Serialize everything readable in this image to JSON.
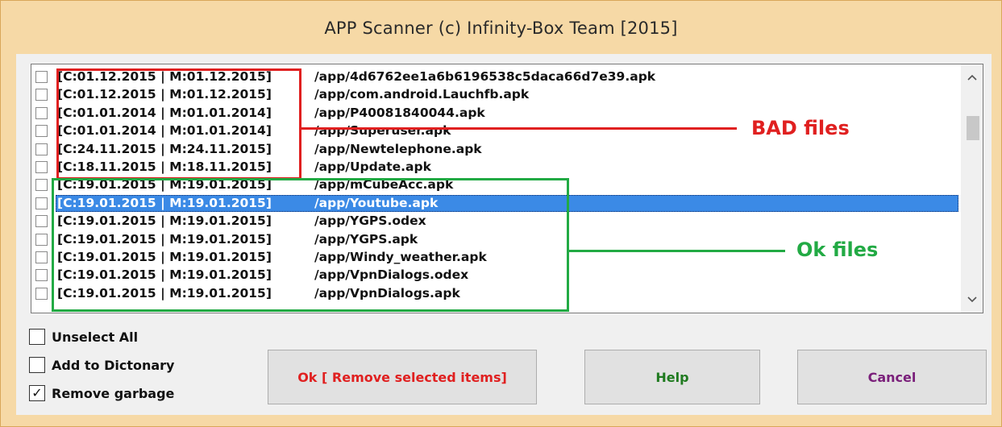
{
  "window": {
    "title": "APP Scanner (c) Infinity-Box Team [2015]"
  },
  "list": {
    "rows": [
      {
        "dates": "[C:01.12.2015 | M:01.12.2015]",
        "path": "/app/4d6762ee1a6b6196538c5daca66d7e39.apk",
        "checked": false
      },
      {
        "dates": "[C:01.12.2015 | M:01.12.2015]",
        "path": "/app/com.android.Lauchfb.apk",
        "checked": false
      },
      {
        "dates": "[C:01.01.2014 | M:01.01.2014]",
        "path": "/app/P40081840044.apk",
        "checked": false
      },
      {
        "dates": "[C:01.01.2014 | M:01.01.2014]",
        "path": "/app/Superuser.apk",
        "checked": false
      },
      {
        "dates": "[C:24.11.2015 | M:24.11.2015]",
        "path": "/app/Newtelephone.apk",
        "checked": false
      },
      {
        "dates": "[C:18.11.2015 | M:18.11.2015]",
        "path": "/app/Update.apk",
        "checked": false
      },
      {
        "dates": "[C:19.01.2015 | M:19.01.2015]",
        "path": "/app/mCubeAcc.apk",
        "checked": false
      },
      {
        "dates": "[C:19.01.2015 | M:19.01.2015]",
        "path": "/app/Youtube.apk",
        "checked": false,
        "selected": true
      },
      {
        "dates": "[C:19.01.2015 | M:19.01.2015]",
        "path": "/app/YGPS.odex",
        "checked": false
      },
      {
        "dates": "[C:19.01.2015 | M:19.01.2015]",
        "path": "/app/YGPS.apk",
        "checked": false
      },
      {
        "dates": "[C:19.01.2015 | M:19.01.2015]",
        "path": "/app/Windy_weather.apk",
        "checked": false
      },
      {
        "dates": "[C:19.01.2015 | M:19.01.2015]",
        "path": "/app/VpnDialogs.odex",
        "checked": false
      },
      {
        "dates": "[C:19.01.2015 | M:19.01.2015]",
        "path": "/app/VpnDialogs.apk",
        "checked": false
      }
    ]
  },
  "annotations": {
    "bad_label": "BAD files",
    "ok_label": "Ok files",
    "bad_color": "#e02020",
    "ok_color": "#22aa44"
  },
  "options": {
    "unselect_all": {
      "label": "Unselect All",
      "checked": false
    },
    "add_to_dictionary": {
      "label": "Add to Dictonary",
      "checked": false
    },
    "remove_garbage": {
      "label": "Remove garbage",
      "checked": true
    }
  },
  "buttons": {
    "ok_label": "Ok [ Remove selected items]",
    "ok_color": "#e02020",
    "help_label": "Help",
    "help_color": "#1f7a1f",
    "cancel_label": "Cancel",
    "cancel_color": "#7a1f7a"
  },
  "icons": {
    "scroll_up": "▲",
    "scroll_down": "▼",
    "checkmark": "✓"
  }
}
